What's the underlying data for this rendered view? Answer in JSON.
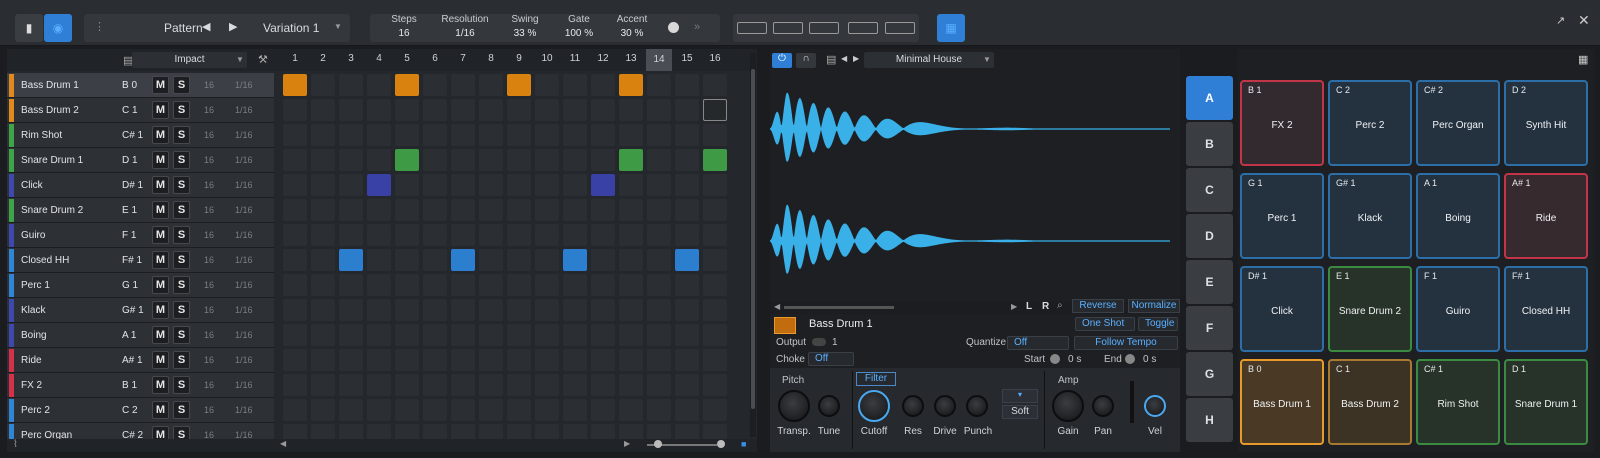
{
  "toolbar": {
    "pattern_label": "Pattern",
    "variation_label": "Variation 1",
    "params": [
      {
        "label": "Steps",
        "value": "16"
      },
      {
        "label": "Resolution",
        "value": "1/16"
      },
      {
        "label": "Swing",
        "value": "33 %"
      },
      {
        "label": "Gate",
        "value": "100 %"
      },
      {
        "label": "Accent",
        "value": "30 %"
      }
    ]
  },
  "kit": {
    "name": "Impact"
  },
  "step_numbers": [
    "1",
    "2",
    "3",
    "4",
    "5",
    "6",
    "7",
    "8",
    "9",
    "10",
    "11",
    "12",
    "13",
    "14",
    "15",
    "16"
  ],
  "mute_label": "M",
  "solo_label": "S",
  "tracks": [
    {
      "name": "Bass Drum 1",
      "note": "B 0",
      "steps": "16",
      "res": "1/16",
      "color": "#e08a1e"
    },
    {
      "name": "Bass Drum 2",
      "note": "C 1",
      "steps": "16",
      "res": "1/16",
      "color": "#e08a1e"
    },
    {
      "name": "Rim Shot",
      "note": "C# 1",
      "steps": "16",
      "res": "1/16",
      "color": "#3fa34a"
    },
    {
      "name": "Snare Drum 1",
      "note": "D 1",
      "steps": "16",
      "res": "1/16",
      "color": "#3fa34a"
    },
    {
      "name": "Click",
      "note": "D# 1",
      "steps": "16",
      "res": "1/16",
      "color": "#3e49b0"
    },
    {
      "name": "Snare Drum 2",
      "note": "E 1",
      "steps": "16",
      "res": "1/16",
      "color": "#3fa34a"
    },
    {
      "name": "Guiro",
      "note": "F 1",
      "steps": "16",
      "res": "1/16",
      "color": "#3e49b0"
    },
    {
      "name": "Closed HH",
      "note": "F# 1",
      "steps": "16",
      "res": "1/16",
      "color": "#2f86d6"
    },
    {
      "name": "Perc 1",
      "note": "G 1",
      "steps": "16",
      "res": "1/16",
      "color": "#2f86d6"
    },
    {
      "name": "Klack",
      "note": "G# 1",
      "steps": "16",
      "res": "1/16",
      "color": "#3e49b0"
    },
    {
      "name": "Boing",
      "note": "A 1",
      "steps": "16",
      "res": "1/16",
      "color": "#3e49b0"
    },
    {
      "name": "Ride",
      "note": "A# 1",
      "steps": "16",
      "res": "1/16",
      "color": "#d6304a"
    },
    {
      "name": "FX 2",
      "note": "B 1",
      "steps": "16",
      "res": "1/16",
      "color": "#d6304a"
    },
    {
      "name": "Perc 2",
      "note": "C 2",
      "steps": "16",
      "res": "1/16",
      "color": "#2f86d6"
    },
    {
      "name": "Perc Organ",
      "note": "C# 2",
      "steps": "16",
      "res": "1/16",
      "color": "#2f86d6"
    }
  ],
  "active_steps": [
    {
      "track": 0,
      "steps": [
        1,
        5,
        9,
        13
      ],
      "color": "#d9820f"
    },
    {
      "track": 3,
      "steps": [
        5,
        13,
        16
      ],
      "color": "#3f9a45"
    },
    {
      "track": 4,
      "steps": [
        4,
        12
      ],
      "color": "#3941a6"
    },
    {
      "track": 7,
      "steps": [
        3,
        7,
        11,
        15
      ],
      "color": "#2c7fcf"
    }
  ],
  "sampler": {
    "preset": "Minimal House",
    "sample_name": "Bass Drum 1",
    "wave_l": "L",
    "wave_r": "R",
    "reverse": "Reverse",
    "normalize": "Normalize",
    "one_shot": "One Shot",
    "toggle": "Toggle",
    "output_label": "Output",
    "output_value": "1",
    "choke_label": "Choke",
    "choke_value": "Off",
    "quantize_label": "Quantize",
    "quantize_value": "Off",
    "follow_tempo": "Follow Tempo",
    "start_label": "Start",
    "start_value": "0 s",
    "end_label": "End",
    "end_value": "0 s",
    "pitch_title": "Pitch",
    "filter_title": "Filter",
    "amp_title": "Amp",
    "soft_label": "Soft",
    "knobs": [
      "Transp.",
      "Tune",
      "Cutoff",
      "Res",
      "Drive",
      "Punch",
      "Gain",
      "Pan",
      "Vel"
    ]
  },
  "banks": [
    "A",
    "B",
    "C",
    "D",
    "E",
    "F",
    "G",
    "H"
  ],
  "pads": [
    {
      "note": "B 1",
      "label": "FX 2",
      "color": "#c23548",
      "bg": "#332a30"
    },
    {
      "note": "C 2",
      "label": "Perc 2",
      "color": "#2b6ea8",
      "bg": "#243240"
    },
    {
      "note": "C# 2",
      "label": "Perc Organ",
      "color": "#2b6ea8",
      "bg": "#243240"
    },
    {
      "note": "D 2",
      "label": "Synth Hit",
      "color": "#2b6ea8",
      "bg": "#243240"
    },
    {
      "note": "G 1",
      "label": "Perc 1",
      "color": "#2b6ea8",
      "bg": "#243240"
    },
    {
      "note": "G# 1",
      "label": "Klack",
      "color": "#2b6ea8",
      "bg": "#243240"
    },
    {
      "note": "A 1",
      "label": "Boing",
      "color": "#2b6ea8",
      "bg": "#243240"
    },
    {
      "note": "A# 1",
      "label": "Ride",
      "color": "#c23548",
      "bg": "#362a2f"
    },
    {
      "note": "D# 1",
      "label": "Click",
      "color": "#2b6ea8",
      "bg": "#243240"
    },
    {
      "note": "E 1",
      "label": "Snare Drum 2",
      "color": "#3a8a42",
      "bg": "#273328"
    },
    {
      "note": "F 1",
      "label": "Guiro",
      "color": "#2b6ea8",
      "bg": "#243240"
    },
    {
      "note": "F# 1",
      "label": "Closed HH",
      "color": "#2b6ea8",
      "bg": "#243240"
    },
    {
      "note": "B 0",
      "label": "Bass Drum 1",
      "color": "#e89a2a",
      "bg": "#4a3a25"
    },
    {
      "note": "C 1",
      "label": "Bass Drum 2",
      "color": "#a87a30",
      "bg": "#3d3325"
    },
    {
      "note": "C# 1",
      "label": "Rim Shot",
      "color": "#3a8a42",
      "bg": "#273328"
    },
    {
      "note": "D 1",
      "label": "Snare Drum 1",
      "color": "#3a8a42",
      "bg": "#273328"
    }
  ]
}
